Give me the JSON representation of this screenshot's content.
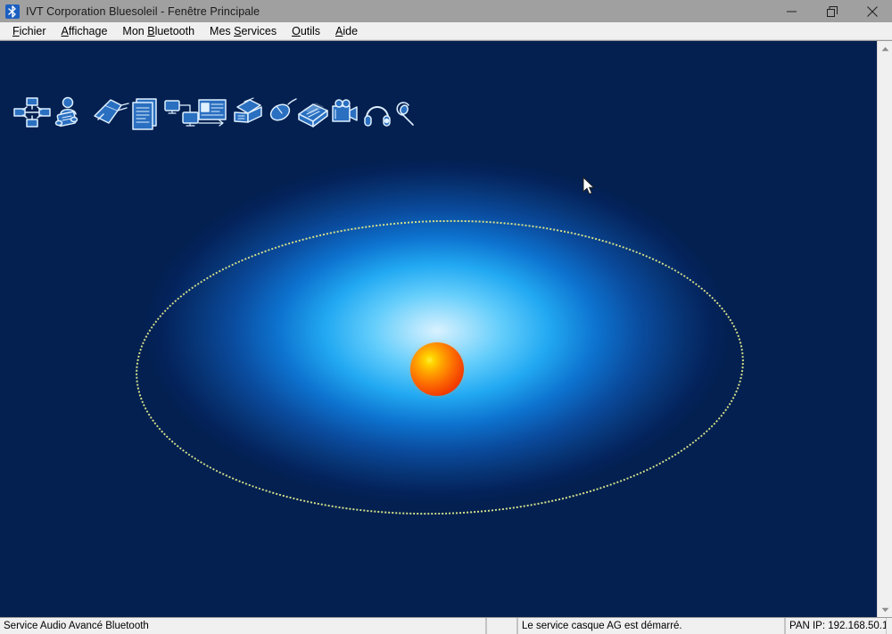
{
  "window": {
    "title": "IVT Corporation Bluesoleil - Fenêtre Principale",
    "icon": "bluetooth-icon",
    "controls": {
      "minimize": "—",
      "restore": "❐",
      "close": "✕",
      "minimize_name": "minimize-button",
      "restore_name": "restore-button",
      "close_name": "close-button"
    }
  },
  "menubar": {
    "items": [
      {
        "label": "Fichier",
        "accel": "F",
        "pre": "",
        "post": "ichier"
      },
      {
        "label": "Affichage",
        "accel": "A",
        "pre": "",
        "post": "ffichage"
      },
      {
        "label": "Mon Bluetooth",
        "accel": "B",
        "pre": "Mon ",
        "post": "luetooth"
      },
      {
        "label": "Mes Services",
        "accel": "S",
        "pre": "Mes ",
        "post": "ervices"
      },
      {
        "label": "Outils",
        "accel": "O",
        "pre": "",
        "post": "utils"
      },
      {
        "label": "Aide",
        "accel": "A",
        "pre": "",
        "post": "ide"
      }
    ]
  },
  "toolbar": {
    "items": [
      {
        "name": "device-search-icon",
        "title": "Rechercher des périphériques"
      },
      {
        "name": "person-telephone-icon",
        "title": "Service téléphone"
      },
      {
        "name": "bluetooth-adapter-icon",
        "title": "Périphérique Bluetooth"
      },
      {
        "name": "document-transfer-icon",
        "title": "Transfert de fichiers"
      },
      {
        "name": "network-nodes-icon",
        "title": "Réseau personnel"
      },
      {
        "name": "business-card-icon",
        "title": "Carte de visite"
      },
      {
        "name": "fax-machine-icon",
        "title": "Fax"
      },
      {
        "name": "mouse-icon",
        "title": "Souris / HID"
      },
      {
        "name": "printer-icon",
        "title": "Imprimante"
      },
      {
        "name": "video-camera-icon",
        "title": "Image / Caméra"
      },
      {
        "name": "headset-icon",
        "title": "Casque"
      },
      {
        "name": "microphone-headset-icon",
        "title": "Casque mains-libres"
      }
    ]
  },
  "canvas": {
    "name": "bluetooth-radar-canvas",
    "center_sphere_name": "local-device-sphere",
    "orbit_name": "device-orbit-ellipse",
    "cursor_name": "mouse-cursor",
    "colors": {
      "background_deep": "#032050",
      "glow_center": "#d9f1ff",
      "glow_mid": "#22a9f2",
      "orbit": "#d5e08a",
      "sphere_highlight": "#ffef3a",
      "sphere_mid": "#fc6a02",
      "sphere_edge": "#b81c00"
    }
  },
  "scrollbar": {
    "up_arrow": "▲",
    "down_arrow": "▼"
  },
  "statusbar": {
    "service": "Service Audio Avancé Bluetooth",
    "spacer": "",
    "message": "Le service casque AG est démarré.",
    "pan_ip": "PAN IP: 192.168.50.1"
  }
}
